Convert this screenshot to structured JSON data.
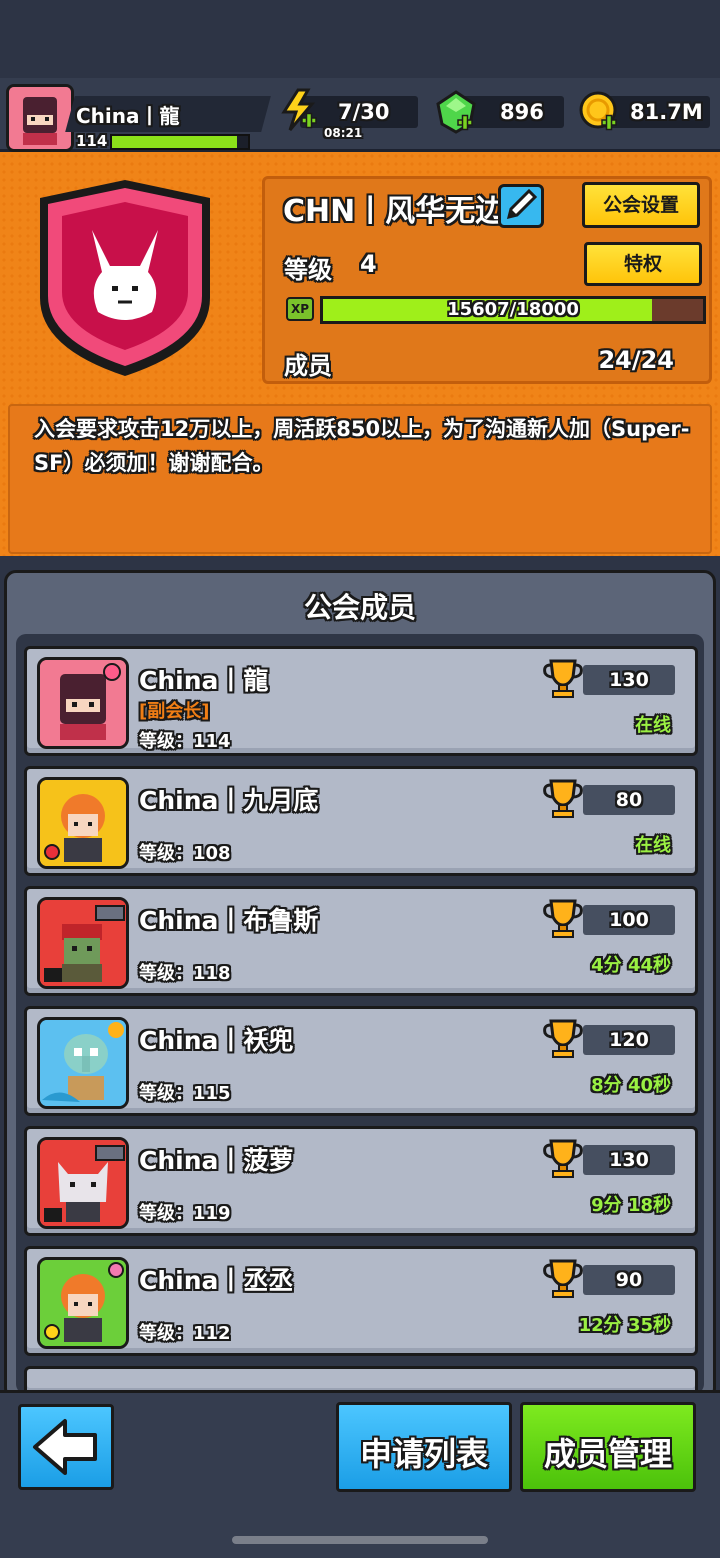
{
  "player": {
    "name": "China丨龍",
    "level": "114",
    "xp_fraction": 0.92
  },
  "resources": {
    "energy": "7/30",
    "energy_timer": "08:21",
    "gems": "896",
    "gold": "81.7M"
  },
  "guild": {
    "name": "CHN丨风华无边",
    "settings_label": "公会设置",
    "privilege_label": "特权",
    "level_label": "等级",
    "level": "4",
    "xp_badge": "XP",
    "xp_text": "15607/18000",
    "xp_fraction": 0.867,
    "members_label": "成员",
    "members_count": "24/24",
    "description": "入会要求攻击12万以上，周活跃850以上，为了沟通新人加（Super-SF）必须加！谢谢配合。"
  },
  "members_title": "公会成员",
  "members": [
    {
      "name": "China丨龍",
      "role": "[副会长]",
      "level": "等级：114",
      "score": "130",
      "status": "在线"
    },
    {
      "name": "China丨九月底",
      "level": "等级：108",
      "score": "80",
      "status": "在线"
    },
    {
      "name": "China丨布鲁斯",
      "level": "等级：118",
      "score": "100",
      "status": "4分 44秒"
    },
    {
      "name": "China丨袄兜",
      "level": "等级：115",
      "score": "120",
      "status": "8分 40秒"
    },
    {
      "name": "China丨菠萝",
      "level": "等级：119",
      "score": "130",
      "status": "9分 18秒"
    },
    {
      "name": "China丨丞丞",
      "level": "等级：112",
      "score": "90",
      "status": "12分 35秒"
    }
  ],
  "buttons": {
    "apply_list": "申请列表",
    "member_manage": "成员管理"
  },
  "colors": {
    "accent_orange": "#f08418",
    "online_green": "#9af043",
    "xp_green": "#9fef1a",
    "button_blue": "#1b9ee6",
    "button_green": "#4cc20b"
  },
  "icons": [
    "back-arrow-icon",
    "edit-pencil-icon",
    "trophy-icon",
    "energy-bolt-icon",
    "gem-icon",
    "gold-coin-icon",
    "llama-emblem-icon"
  ]
}
